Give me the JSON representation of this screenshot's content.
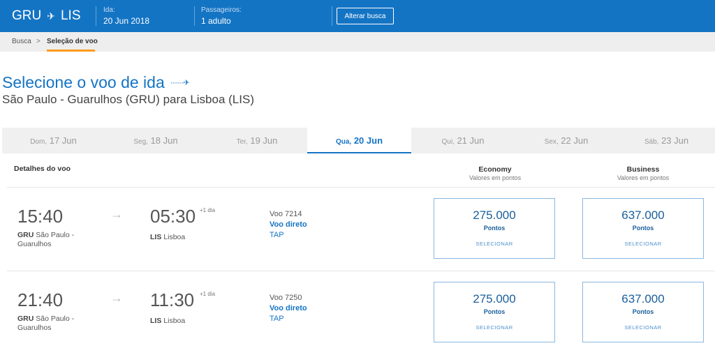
{
  "header": {
    "origin": "GRU",
    "destination": "LIS",
    "date_label": "Ida:",
    "date_value": "20 Jun 2018",
    "pax_label": "Passageiros:",
    "pax_value": "1 adulto",
    "alter_button": "Alterar busca",
    "background_color": "#1474c4"
  },
  "breadcrumb": {
    "items": [
      "Busca",
      "Seleção de voo"
    ],
    "separator": ">"
  },
  "page": {
    "title": "Selecione o voo de ida",
    "subtitle_from": "São Paulo - Guarulhos (GRU)",
    "subtitle_connector": "para",
    "subtitle_to": "Lisboa (LIS)"
  },
  "dates": [
    {
      "dow": "Dom,",
      "day": "17 Jun"
    },
    {
      "dow": "Seg,",
      "day": "18 Jun"
    },
    {
      "dow": "Ter,",
      "day": "19 Jun"
    },
    {
      "dow": "Qua,",
      "day": "20 Jun",
      "active": true
    },
    {
      "dow": "Qui,",
      "day": "21 Jun"
    },
    {
      "dow": "Sex,",
      "day": "22 Jun"
    },
    {
      "dow": "Sáb,",
      "day": "23 Jun"
    }
  ],
  "table": {
    "details_header": "Detalhes do voo",
    "economy_header": "Economy",
    "economy_sub": "Valores em pontos",
    "business_header": "Business",
    "business_sub": "Valores em pontos"
  },
  "flights": [
    {
      "dep_time": "15:40",
      "dep_code": "GRU",
      "dep_city": "São Paulo -",
      "dep_city2": "Guarulhos",
      "arr_time": "05:30",
      "arr_plus": "+1 dia",
      "arr_code": "LIS",
      "arr_city": "Lisboa",
      "flight_no": "Voo 7214",
      "type": "Voo direto",
      "airline": "TAP",
      "economy_points": "275.000",
      "business_points": "637.000",
      "points_label": "Pontos",
      "select_label": "SELECIONAR"
    },
    {
      "dep_time": "21:40",
      "dep_code": "GRU",
      "dep_city": "São Paulo -",
      "dep_city2": "Guarulhos",
      "arr_time": "11:30",
      "arr_plus": "+1 dia",
      "arr_code": "LIS",
      "arr_city": "Lisboa",
      "flight_no": "Voo 7250",
      "type": "Voo direto",
      "airline": "TAP",
      "economy_points": "275.000",
      "business_points": "637.000",
      "points_label": "Pontos",
      "select_label": "SELECIONAR"
    }
  ]
}
